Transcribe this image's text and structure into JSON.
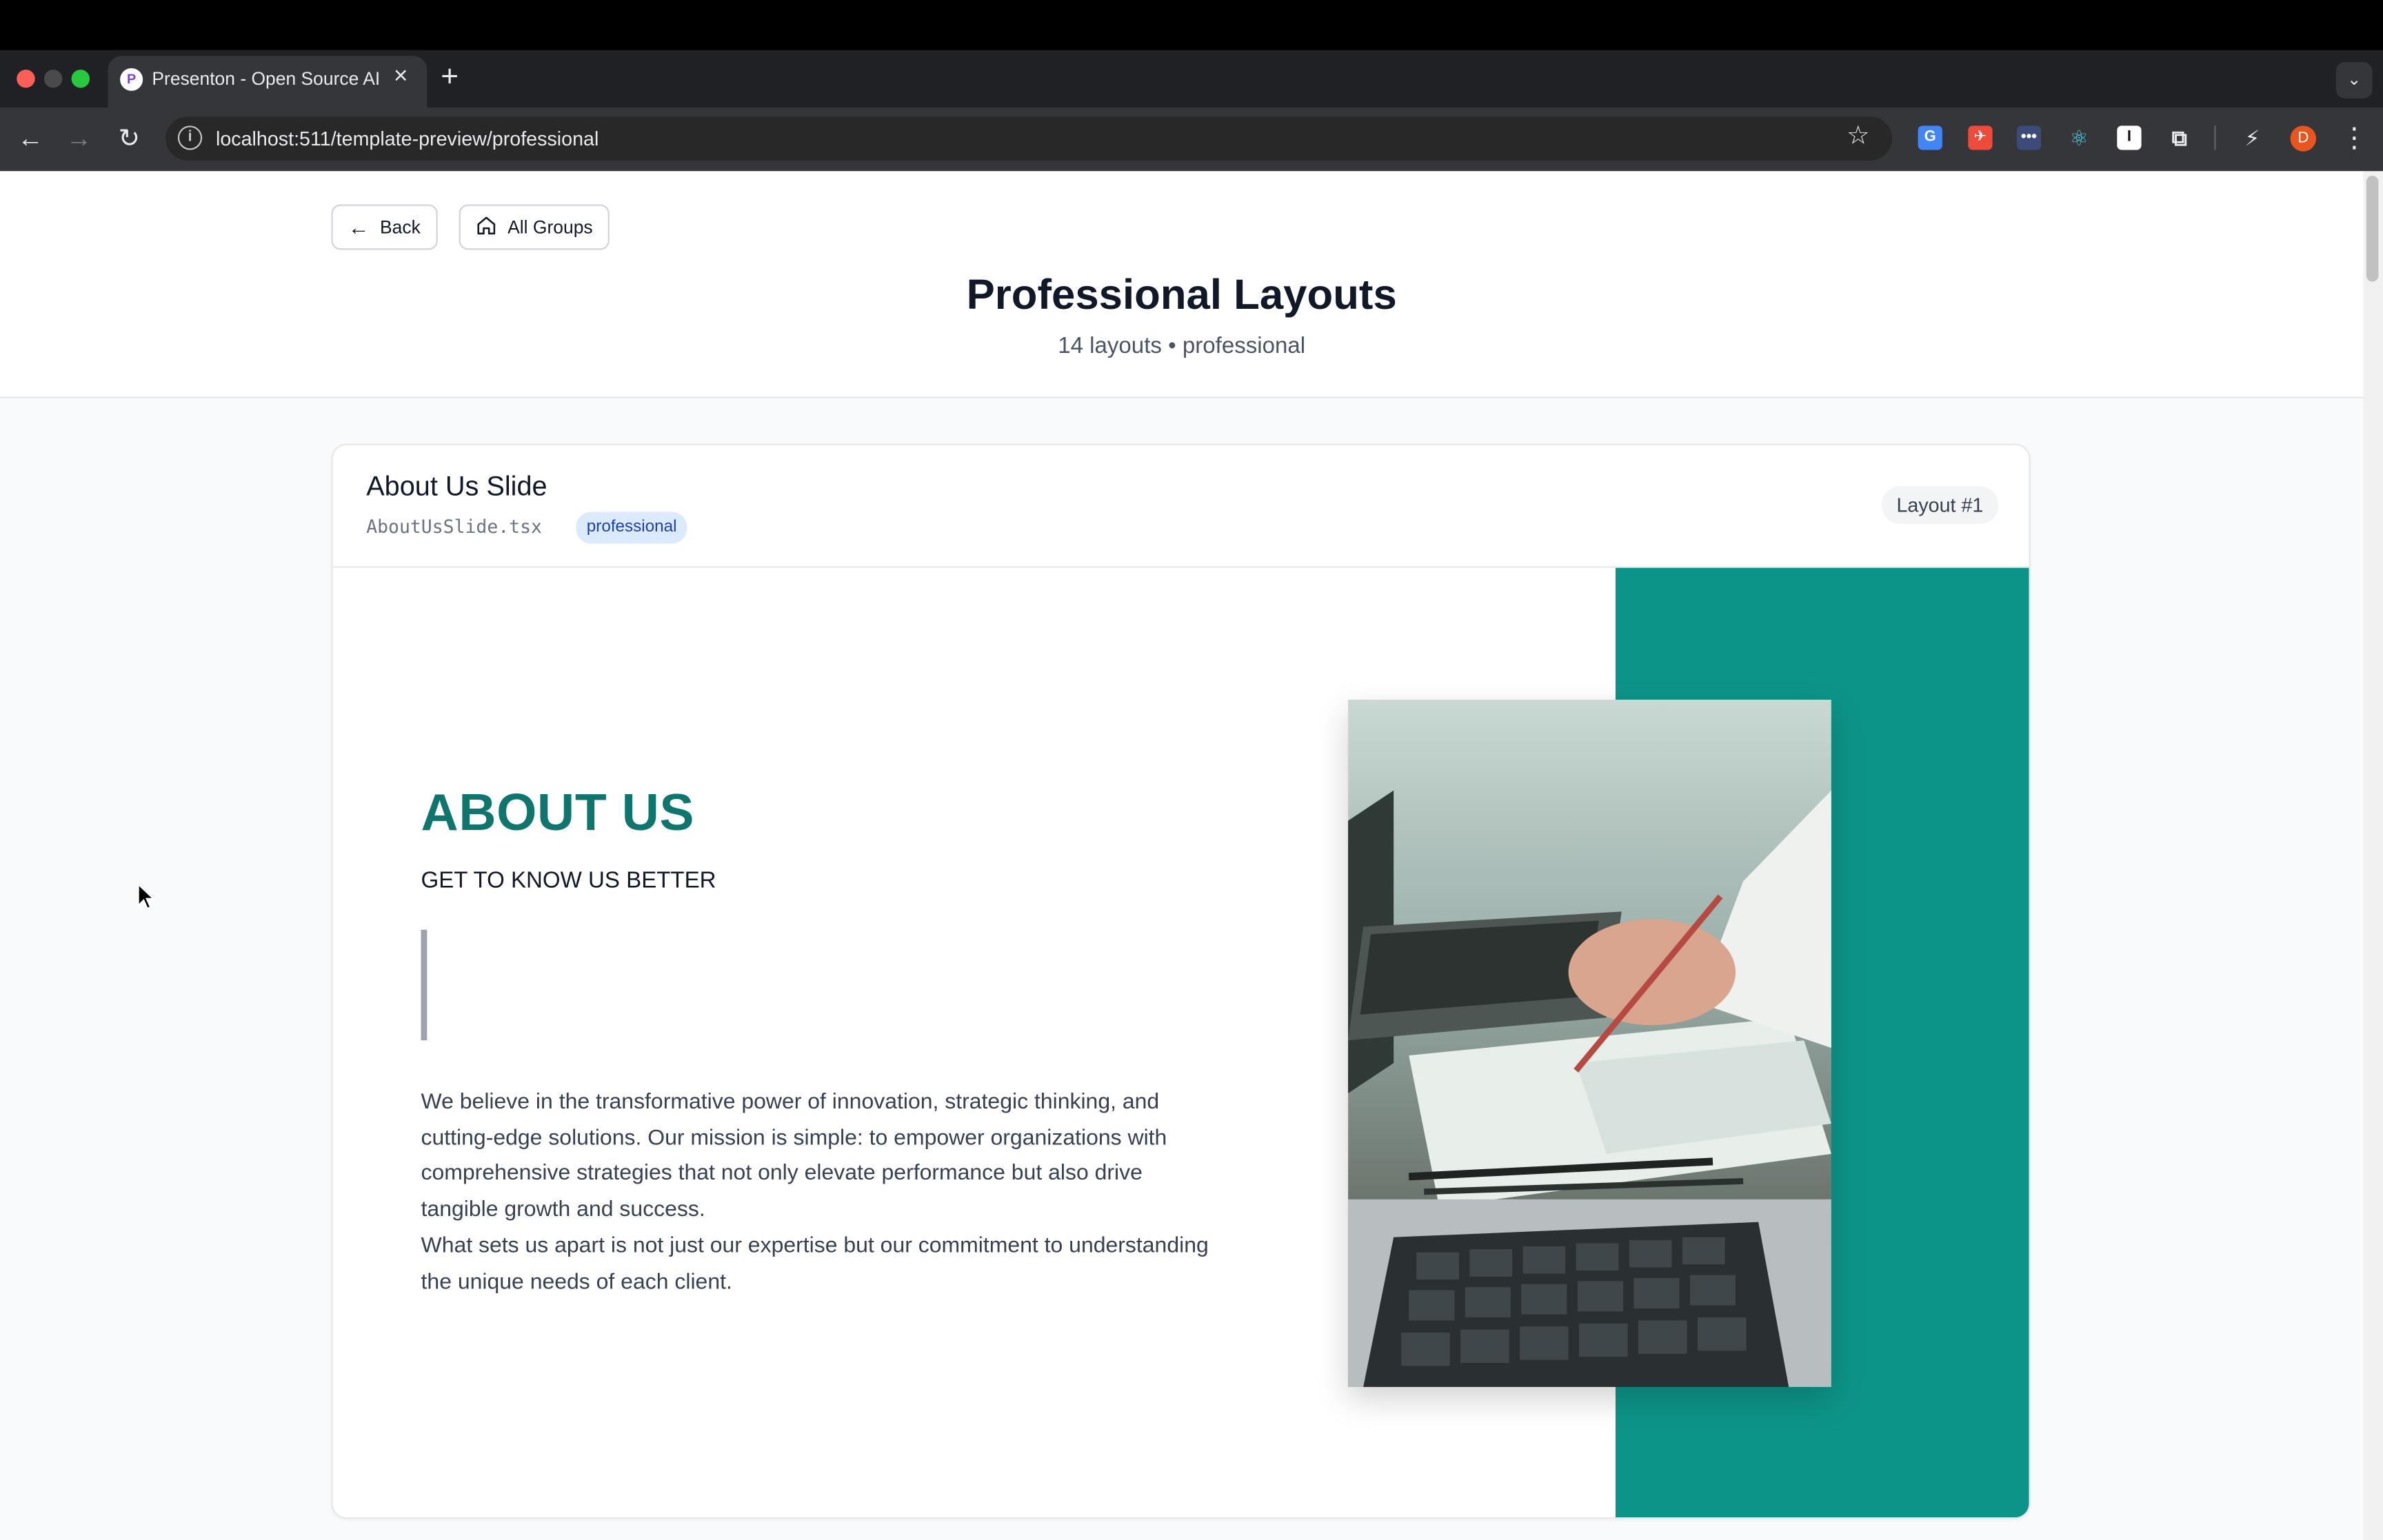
{
  "browser": {
    "tab_title": "Presenton - Open Source AI p",
    "tab_favicon": "P",
    "url": "localhost:511/template-preview/professional",
    "avatar_initial": "D"
  },
  "header": {
    "back_label": "Back",
    "all_groups_label": "All Groups",
    "title": "Professional Layouts",
    "subtitle": "14 layouts • professional"
  },
  "card": {
    "title": "About Us Slide",
    "file": "AboutUsSlide.tsx",
    "badge": "professional",
    "layout_number": "Layout #1"
  },
  "slide": {
    "heading": "ABOUT US",
    "subheading": "GET TO KNOW US BETTER",
    "body_1": "We believe in the transformative power of innovation, strategic thinking, and cutting-edge solutions. Our mission is simple: to empower organizations with comprehensive strategies that not only elevate performance but also drive tangible growth and success.",
    "body_2": "What sets us apart is not just our expertise but our commitment to understanding the unique needs of each client.",
    "accent_color": "#0d9488",
    "heading_color": "#0f766e"
  }
}
